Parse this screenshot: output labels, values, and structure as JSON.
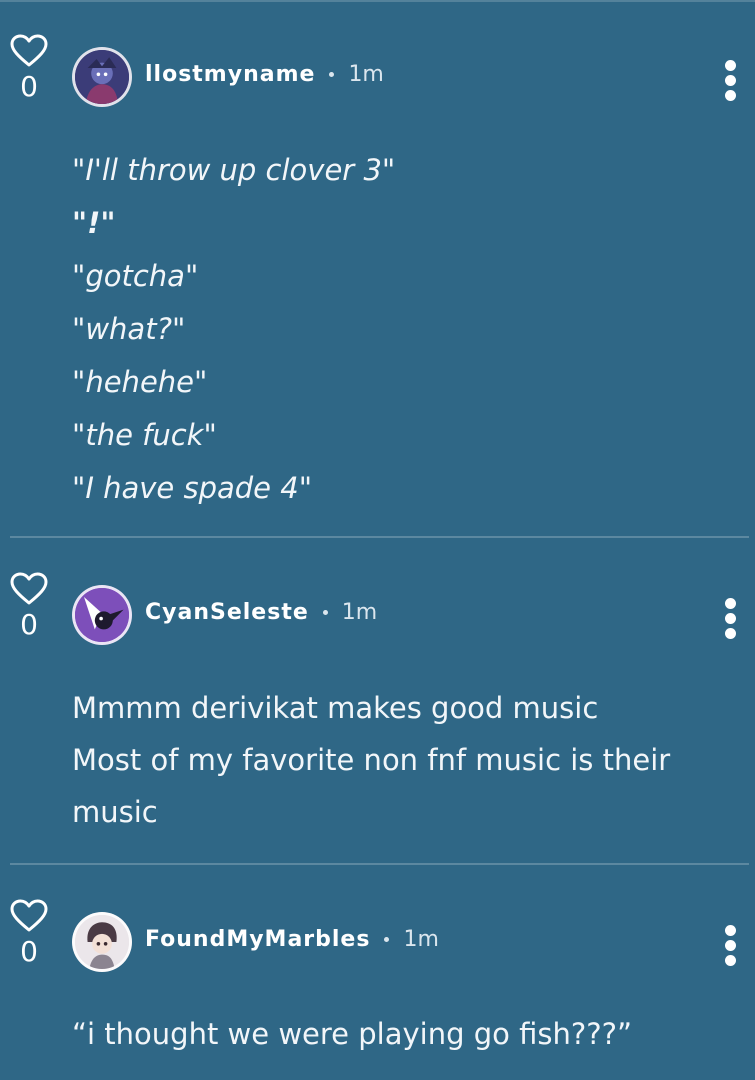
{
  "comments": [
    {
      "likes": "0",
      "username": "llostmyname",
      "time": "1m",
      "lines": [
        "\"I'll throw up clover 3\"",
        "\"!\"",
        "\"gotcha\"",
        "\"what?\"",
        "\"hehehe\"",
        "\"the fuck\"",
        "\"I have spade 4\""
      ]
    },
    {
      "likes": "0",
      "username": "CyanSeleste",
      "time": "1m",
      "lines": [
        "Mmmm derivikat makes good music",
        "Most of my favorite non fnf music is their music"
      ]
    },
    {
      "likes": "0",
      "username": "FoundMyMarbles",
      "time": "1m",
      "lines": [
        "“i thought we were playing go fish???”"
      ]
    }
  ],
  "icons": {
    "like": "heart-outline-icon",
    "more": "vertical-dots-icon"
  },
  "colors": {
    "background": "#2f6786",
    "text": "#ffffff",
    "divider": "rgba(255,255,255,0.22)"
  }
}
